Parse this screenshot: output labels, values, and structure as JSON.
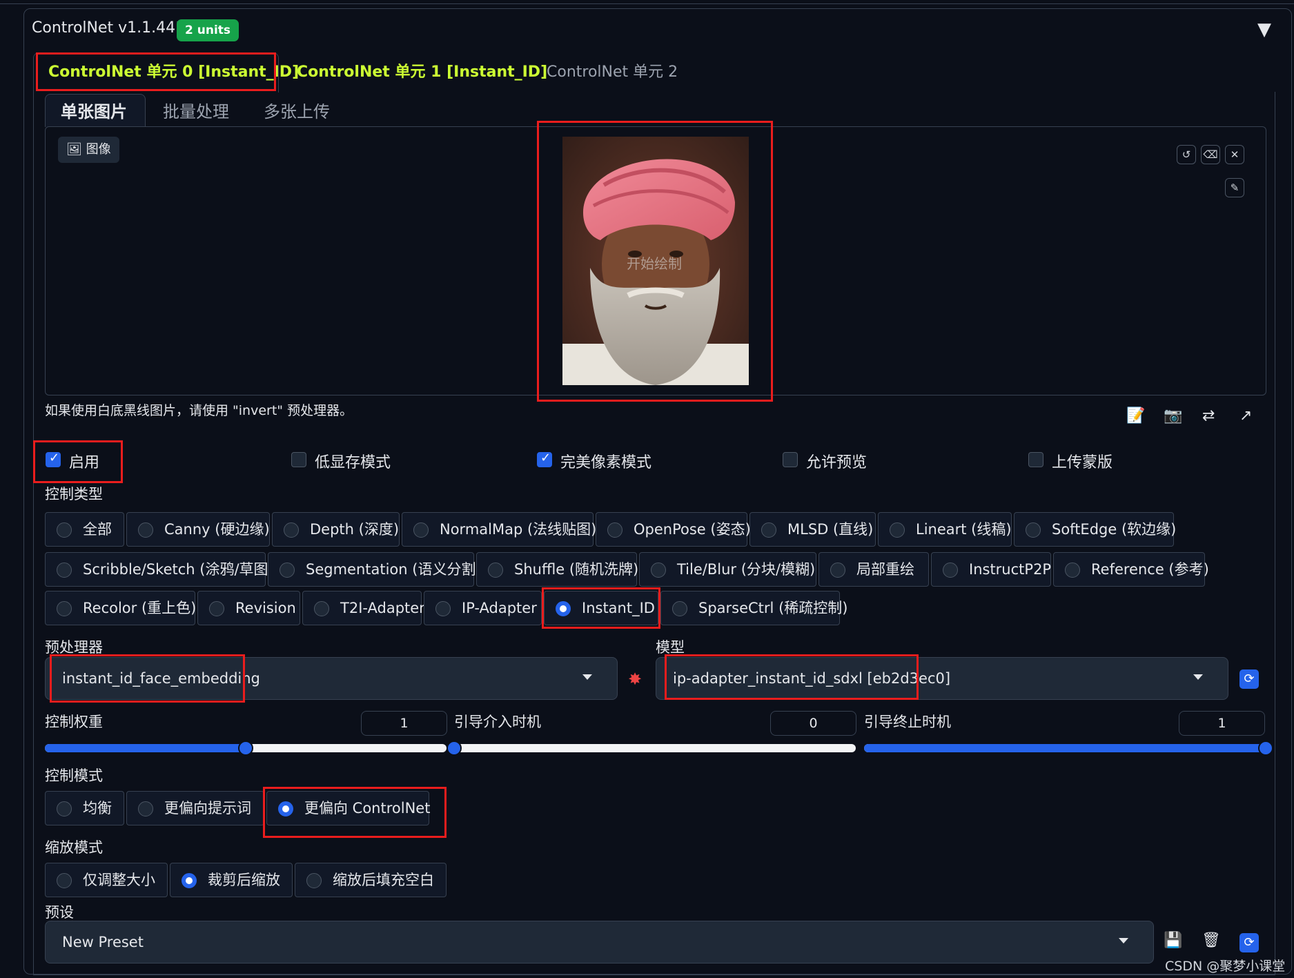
{
  "header": {
    "title": "ControlNet v1.1.441",
    "badge": "2 units",
    "collapse_icon": "caret-down-icon"
  },
  "unit_tabs": [
    {
      "label": "ControlNet 单元 0 [Instant_ID]",
      "state": "active"
    },
    {
      "label": "ControlNet 单元 1 [Instant_ID]",
      "state": "enabled"
    },
    {
      "label": "ControlNet 单元 2",
      "state": "inactive"
    }
  ],
  "input_tabs": [
    {
      "label": "单张图片"
    },
    {
      "label": "批量处理"
    },
    {
      "label": "多张上传"
    }
  ],
  "image_panel": {
    "label": "图像",
    "overlay_text": "开始绘制",
    "tools": [
      "undo-icon",
      "eraser-icon",
      "close-icon",
      "brush-icon"
    ]
  },
  "hint": "如果使用白底黑线图片，请使用 \"invert\" 预处理器。",
  "action_icons": [
    "notepad-icon",
    "camera-icon",
    "swap-icon",
    "send-dimensions-icon"
  ],
  "checkboxes": [
    {
      "label": "启用",
      "checked": true
    },
    {
      "label": "低显存模式",
      "checked": false
    },
    {
      "label": "完美像素模式",
      "checked": true
    },
    {
      "label": "允许预览",
      "checked": false
    },
    {
      "label": "上传蒙版",
      "checked": false
    }
  ],
  "control_type": {
    "label": "控制类型",
    "options": [
      "全部",
      "Canny (硬边缘)",
      "Depth (深度)",
      "NormalMap (法线贴图)",
      "OpenPose (姿态)",
      "MLSD (直线)",
      "Lineart (线稿)",
      "SoftEdge (软边缘)",
      "Scribble/Sketch (涂鸦/草图)",
      "Segmentation (语义分割)",
      "Shuffle (随机洗牌)",
      "Tile/Blur (分块/模糊)",
      "局部重绘",
      "InstructP2P",
      "Reference (参考)",
      "Recolor (重上色)",
      "Revision",
      "T2I-Adapter",
      "IP-Adapter",
      "Instant_ID",
      "SparseCtrl (稀疏控制)"
    ],
    "selected": "Instant_ID"
  },
  "preprocessor": {
    "label": "预处理器",
    "value": "instant_id_face_embedding",
    "run_icon": "explosion-icon"
  },
  "model": {
    "label": "模型",
    "value": "ip-adapter_instant_id_sdxl [eb2d3ec0]",
    "refresh_icon": "refresh-icon"
  },
  "sliders": [
    {
      "label": "控制权重",
      "value": "1",
      "min": 0,
      "max": 2,
      "num": 1
    },
    {
      "label": "引导介入时机",
      "value": "0",
      "min": 0,
      "max": 1,
      "num": 0
    },
    {
      "label": "引导终止时机",
      "value": "1",
      "min": 0,
      "max": 1,
      "num": 1
    }
  ],
  "control_mode": {
    "label": "控制模式",
    "options": [
      "均衡",
      "更偏向提示词",
      "更偏向 ControlNet"
    ],
    "selected": "更偏向 ControlNet"
  },
  "resize_mode": {
    "label": "缩放模式",
    "options": [
      "仅调整大小",
      "裁剪后缩放",
      "缩放后填充空白"
    ],
    "selected": "裁剪后缩放"
  },
  "preset": {
    "label": "预设",
    "value": "New Preset",
    "icons": [
      "save-icon",
      "delete-icon",
      "refresh-icon"
    ]
  },
  "watermark": "CSDN @聚梦小课堂",
  "colors": {
    "accent": "#2563eb",
    "tab_active": "#ccff33",
    "badge": "#16a34a",
    "highlight": "#ea1d1d",
    "bg": "#0b0f19"
  }
}
